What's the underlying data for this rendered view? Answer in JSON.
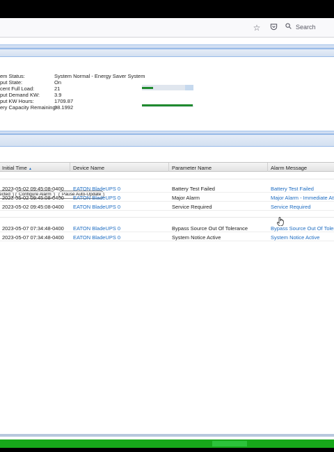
{
  "browser": {
    "search_placeholder": "Search"
  },
  "status": {
    "rows": [
      {
        "label": "em Status:",
        "value": "System Normal - Energy Saver System"
      },
      {
        "label": "put State:",
        "value": "On"
      },
      {
        "label": "cent Full Load:",
        "value": "21"
      },
      {
        "label": "put Demand KW:",
        "value": "3.9"
      },
      {
        "label": "put KW Hours:",
        "value": "1709.87"
      },
      {
        "label": "ery Capacity Remaining:",
        "value": "98.1992"
      }
    ],
    "load_percent": 21,
    "battery_percent": 98.1992
  },
  "toolbar": {
    "selected_label": "ected",
    "configure_label": "Configure Alarm",
    "pause_label": "Pause Auto-Update"
  },
  "grid": {
    "columns": [
      "Initial Time",
      "Device Name",
      "Parameter Name",
      "Alarm Message"
    ],
    "sort_indicator": "▲",
    "rows": [
      {
        "time": "2023-05-02 09:45:08-0400",
        "device": "EATON BladeUPS 0",
        "param": "Battery Test Failed",
        "message": "Battery Test Failed"
      },
      {
        "time": "2023-05-02 09:45:08-0400",
        "device": "EATON BladeUPS 0",
        "param": "Major Alarm",
        "message": "Major Alarm - Immediate Att"
      },
      {
        "time": "2023-05-02 09:45:08-0400",
        "device": "EATON BladeUPS 0",
        "param": "Service Required",
        "message": "Service Required"
      },
      {
        "time": "2023-05-07 07:34:48-0400",
        "device": "EATON BladeUPS 0",
        "param": "Bypass Source Out Of Tolerance",
        "message": "Bypass Source Out Of Tolera"
      },
      {
        "time": "2023-05-07 07:34:48-0400",
        "device": "EATON BladeUPS 0",
        "param": "System Notice Active",
        "message": "System Notice Active"
      }
    ]
  },
  "colors": {
    "link": "#1d6cc2",
    "bar_green": "#1f8a2e",
    "footer_green": "#17a81a"
  },
  "icons": [
    "star-icon",
    "pocket-icon",
    "search-icon",
    "sort-ascending-icon",
    "hand-cursor-icon"
  ]
}
